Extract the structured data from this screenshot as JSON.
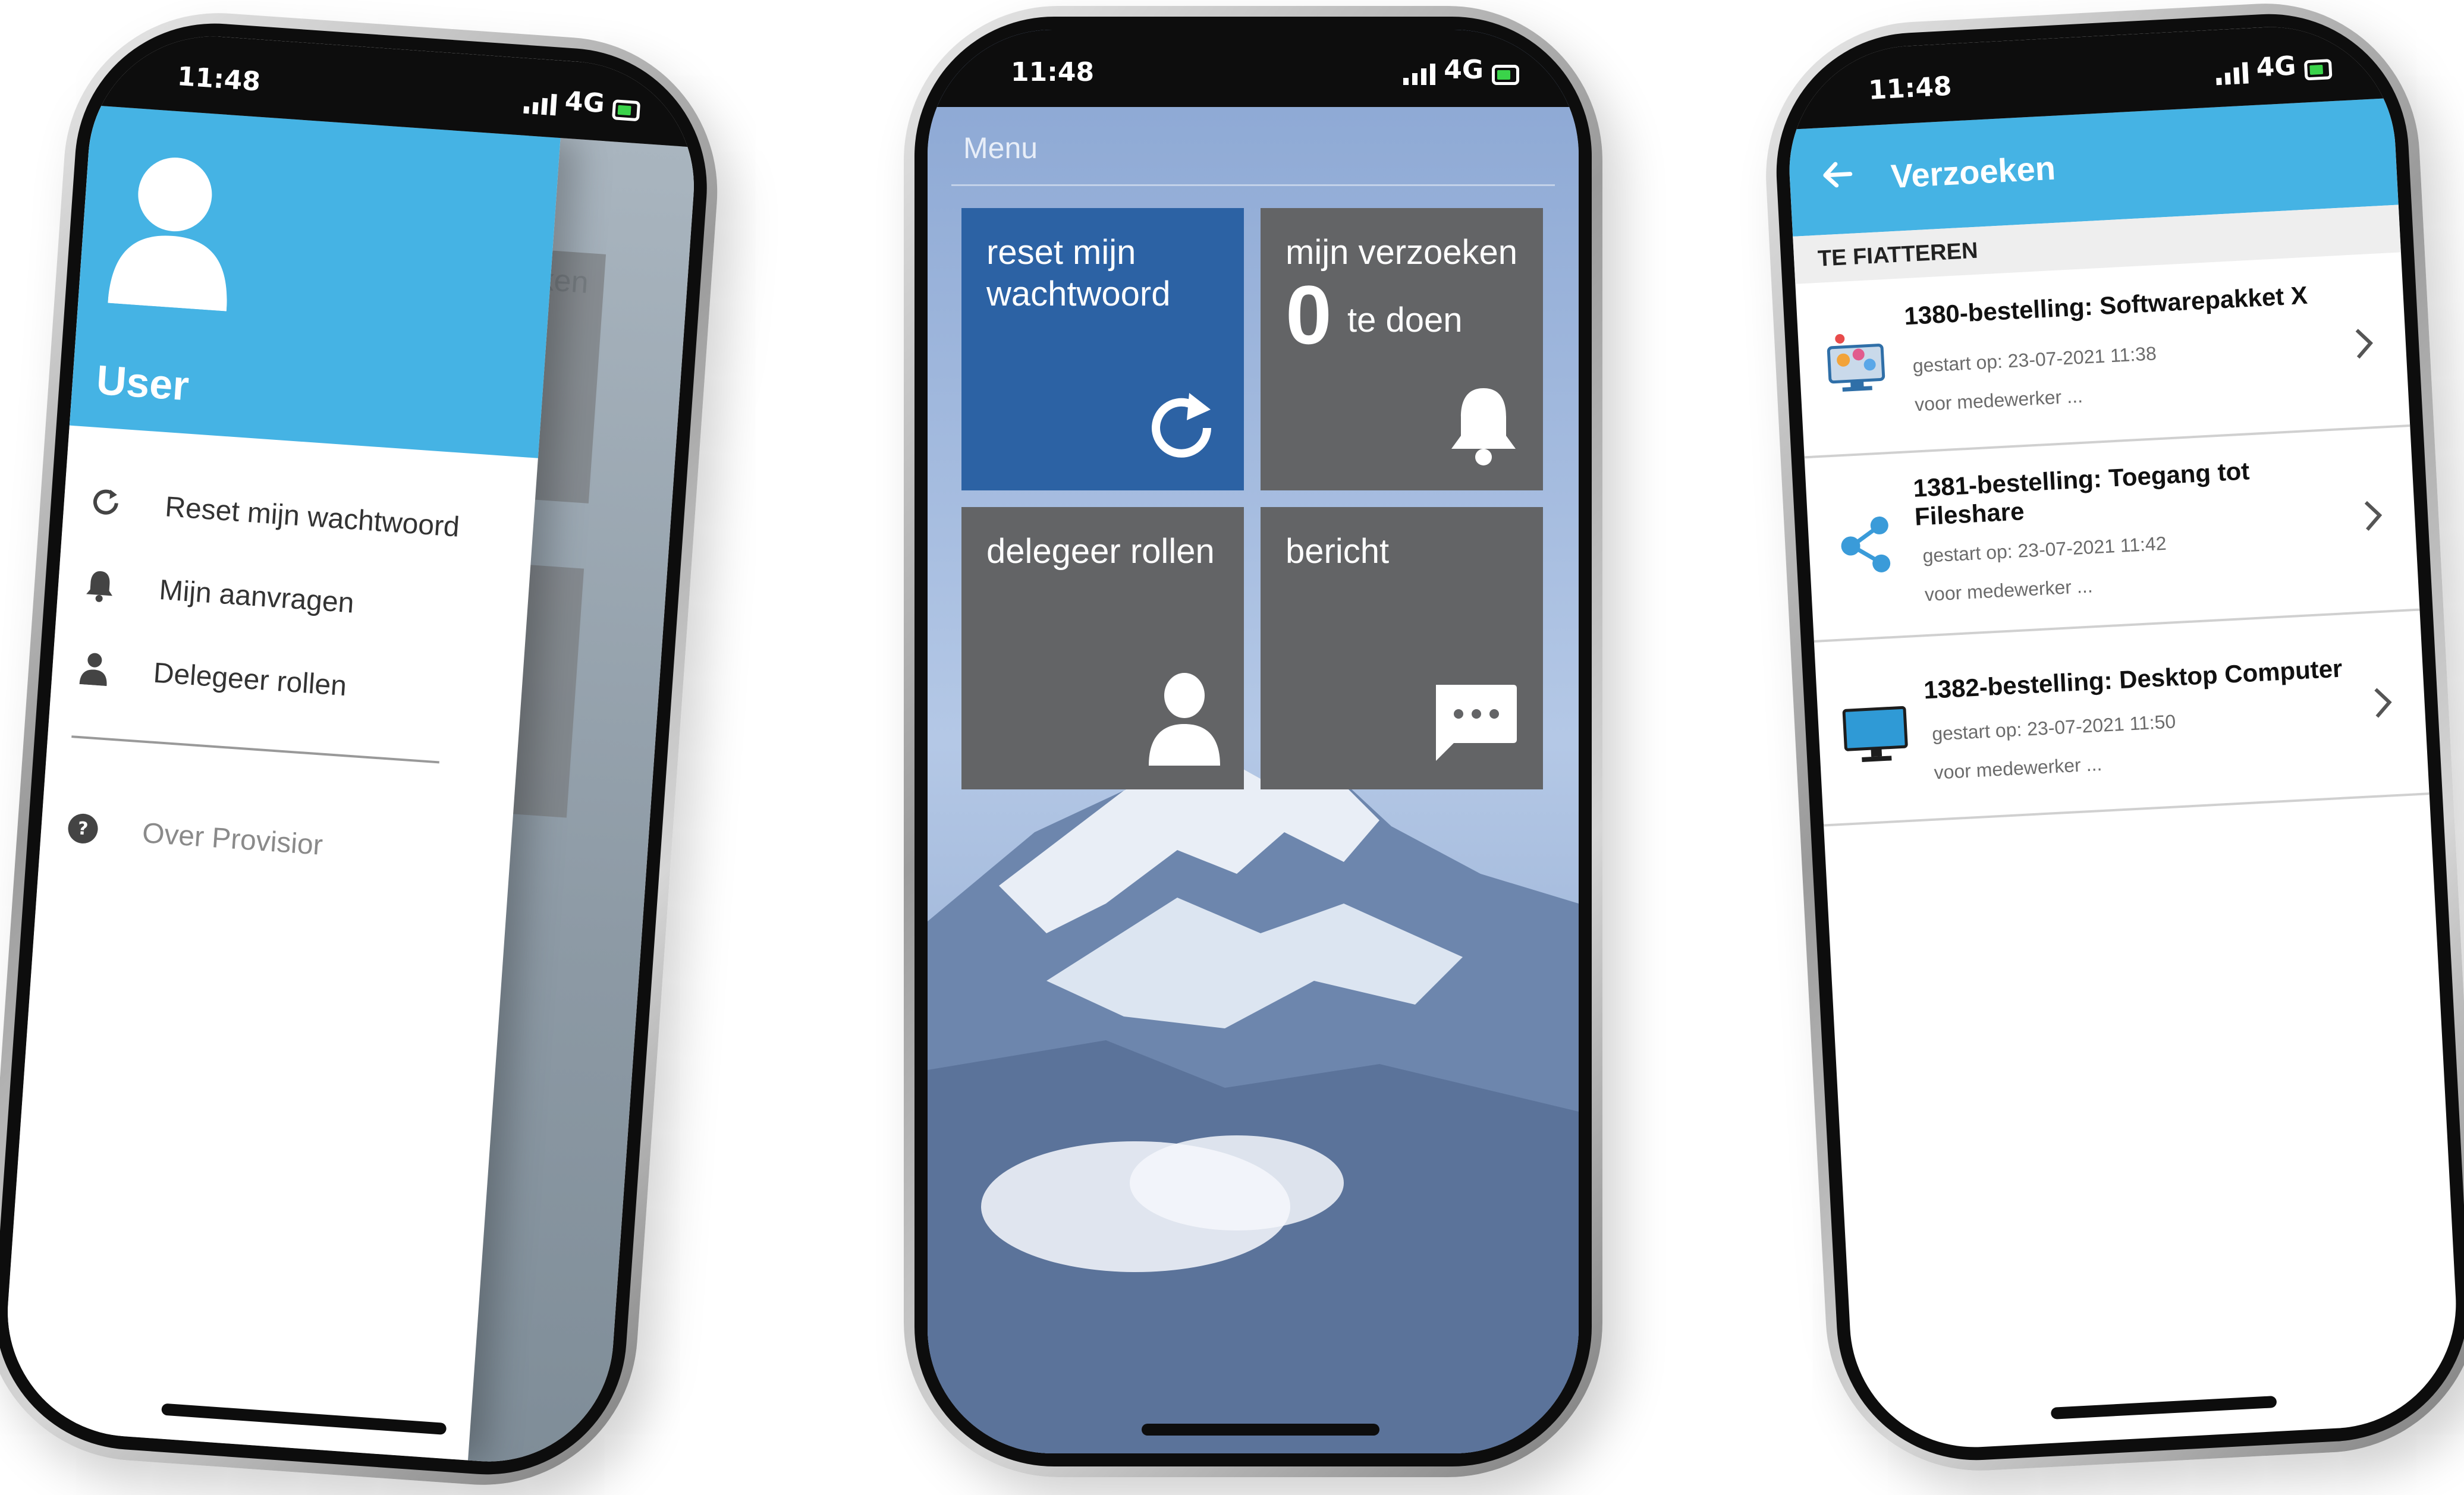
{
  "status": {
    "time": "11:48",
    "network": "4G"
  },
  "left": {
    "drawer": {
      "user_name": "User",
      "items": [
        {
          "label": "Reset mijn wachtwoord",
          "icon": "refresh-icon"
        },
        {
          "label": "Mijn aanvragen",
          "icon": "bell-icon"
        },
        {
          "label": "Delegeer rollen",
          "icon": "person-icon"
        }
      ],
      "about": {
        "label": "Over Provisior",
        "icon": "help-icon"
      }
    },
    "background_peek": "ken"
  },
  "middle": {
    "menu_label": "Menu",
    "tiles": [
      {
        "label": "reset mijn wachtwoord",
        "icon": "refresh-icon",
        "color": "#2c62a4"
      },
      {
        "label": "mijn verzoeken",
        "count": "0",
        "count_label": "te doen",
        "icon": "bell-icon",
        "color": "#636466"
      },
      {
        "label": "delegeer rollen",
        "icon": "person-icon",
        "color": "#636466"
      },
      {
        "label": "bericht",
        "icon": "chat-icon",
        "color": "#636466"
      }
    ]
  },
  "right": {
    "title": "Verzoeken",
    "section": "TE FIATTEREN",
    "requests": [
      {
        "title": "1380-bestelling: Softwarepakket X",
        "started": "gestart op: 23-07-2021 11:38",
        "for": "voor medewerker ...",
        "icon": "software-package-icon"
      },
      {
        "title": "1381-bestelling: Toegang tot Fileshare",
        "started": "gestart op: 23-07-2021 11:42",
        "for": "voor medewerker ...",
        "icon": "share-icon"
      },
      {
        "title": "1382-bestelling: Desktop Computer",
        "started": "gestart op: 23-07-2021 11:50",
        "for": "voor medewerker ...",
        "icon": "desktop-icon"
      }
    ]
  },
  "colors": {
    "accent": "#45b3e4",
    "tile_blue": "#2c62a4",
    "tile_grey": "#636466"
  }
}
